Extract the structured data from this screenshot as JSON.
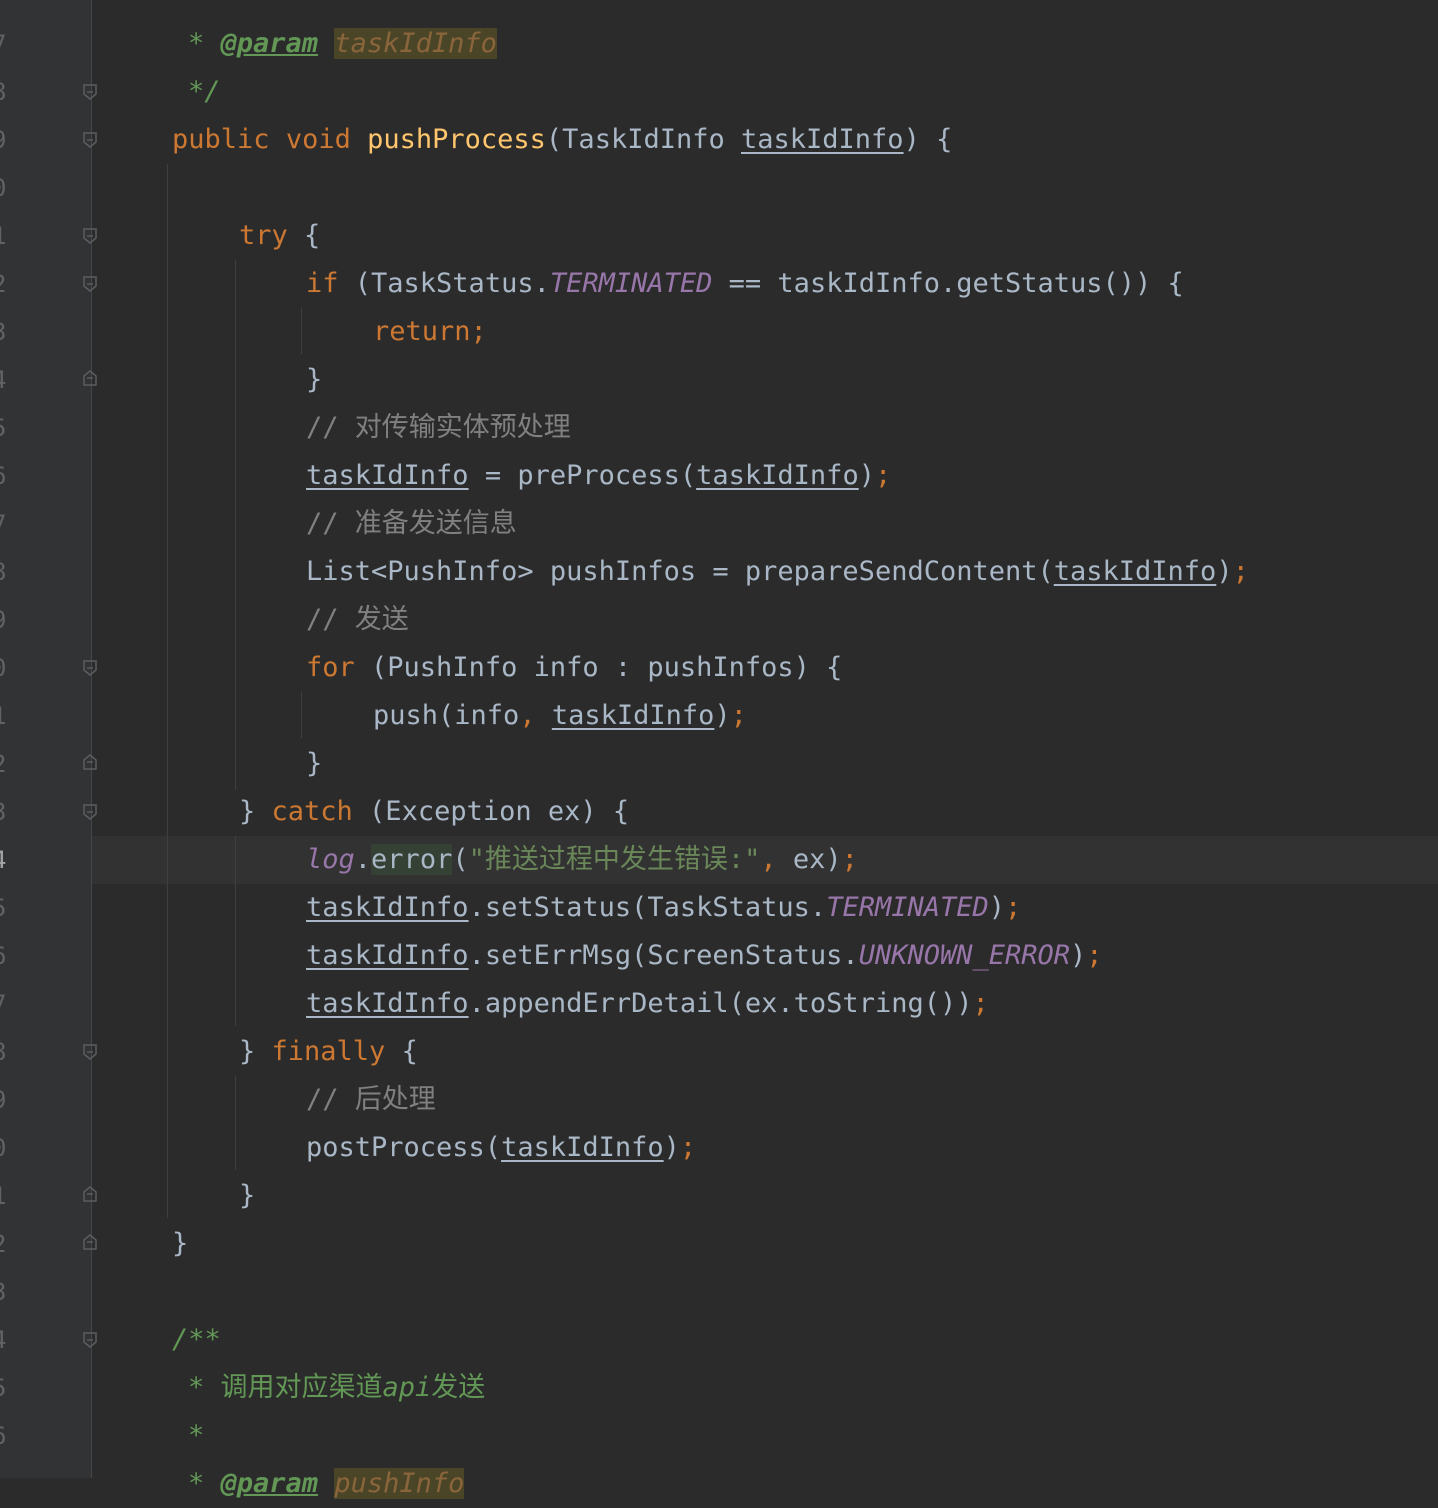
{
  "editor": {
    "line_numbers": [
      "7",
      "8",
      "9",
      "0",
      "1",
      "2",
      "3",
      "4",
      "5",
      "6",
      "7",
      "8",
      "9",
      "0",
      "1",
      "2",
      "3",
      "4",
      "5",
      "6",
      "7",
      "8",
      "9",
      "0",
      "1",
      "2",
      "3",
      "4",
      "5",
      "6"
    ],
    "current_line_number": "4",
    "code": {
      "l1_star": "* ",
      "l1_param_tag": "@param",
      "l1_param_name": "taskIdInfo",
      "l2_end": "*/",
      "l3_public": "public",
      "l3_void": "void",
      "l3_method": "pushProcess",
      "l3_open": "(TaskIdInfo ",
      "l3_param": "taskIdInfo",
      "l3_close": ") {",
      "l5_try": "try",
      "l5_brace": " {",
      "l6_if": "if",
      "l6_part1": " (TaskStatus.",
      "l6_const": "TERMINATED",
      "l6_part2": " == taskIdInfo.getStatus()) {",
      "l7_return": "return;",
      "l8_brace": "}",
      "l9_comment": "// 对传输实体预处理",
      "l10_var": "taskIdInfo",
      "l10_part": " = preProcess(",
      "l10_arg": "taskIdInfo",
      "l10_close": ")",
      "l10_semi": ";",
      "l11_comment": "// 准备发送信息",
      "l12_part": "List<PushInfo> pushInfos = prepareSendContent(",
      "l12_arg": "taskIdInfo",
      "l12_close": ")",
      "l12_semi": ";",
      "l13_comment": "// 发送",
      "l14_for": "for",
      "l14_part": " (PushInfo info : pushInfos) {",
      "l15_part": "push(info",
      "l15_comma": ", ",
      "l15_arg": "taskIdInfo",
      "l15_close": ")",
      "l15_semi": ";",
      "l16_brace": "}",
      "l17_brace": "} ",
      "l17_catch": "catch",
      "l17_part": " (Exception ex) {",
      "l18_log": "log",
      "l18_dot": ".",
      "l18_error": "error",
      "l18_open": "(",
      "l18_string": "\"推送过程中发生错误:\"",
      "l18_comma": ", ",
      "l18_rest": "ex)",
      "l18_semi": ";",
      "l19_var": "taskIdInfo",
      "l19_part": ".setStatus(TaskStatus.",
      "l19_const": "TERMINATED",
      "l19_close": ")",
      "l19_semi": ";",
      "l20_var": "taskIdInfo",
      "l20_part": ".setErrMsg(ScreenStatus.",
      "l20_const": "UNKNOWN_ERROR",
      "l20_close": ")",
      "l20_semi": ";",
      "l21_var": "taskIdInfo",
      "l21_part": ".appendErrDetail(ex.toString())",
      "l21_semi": ";",
      "l22_brace": "} ",
      "l22_finally": "finally",
      "l22_open": " {",
      "l23_comment": "// 后处理",
      "l24_part": "postProcess(",
      "l24_arg": "taskIdInfo",
      "l24_close": ")",
      "l24_semi": ";",
      "l25_brace": "}",
      "l26_brace": "}",
      "l28_doc_open": "/**",
      "l29_doc": "* 调用对应渠道",
      "l29_doc_api": "api",
      "l29_doc_end": "发送",
      "l30_doc": "*",
      "l31_doc_star": "* ",
      "l31_param_tag": "@param",
      "l31_param_name": "pushInfo"
    }
  },
  "colors": {
    "background": "#2b2b2b",
    "keyword": "#cc7832",
    "method": "#ffc66d",
    "comment": "#808080",
    "doc_comment": "#629755",
    "constant": "#9876aa",
    "string": "#6a8759",
    "text": "#a9b7c6"
  }
}
